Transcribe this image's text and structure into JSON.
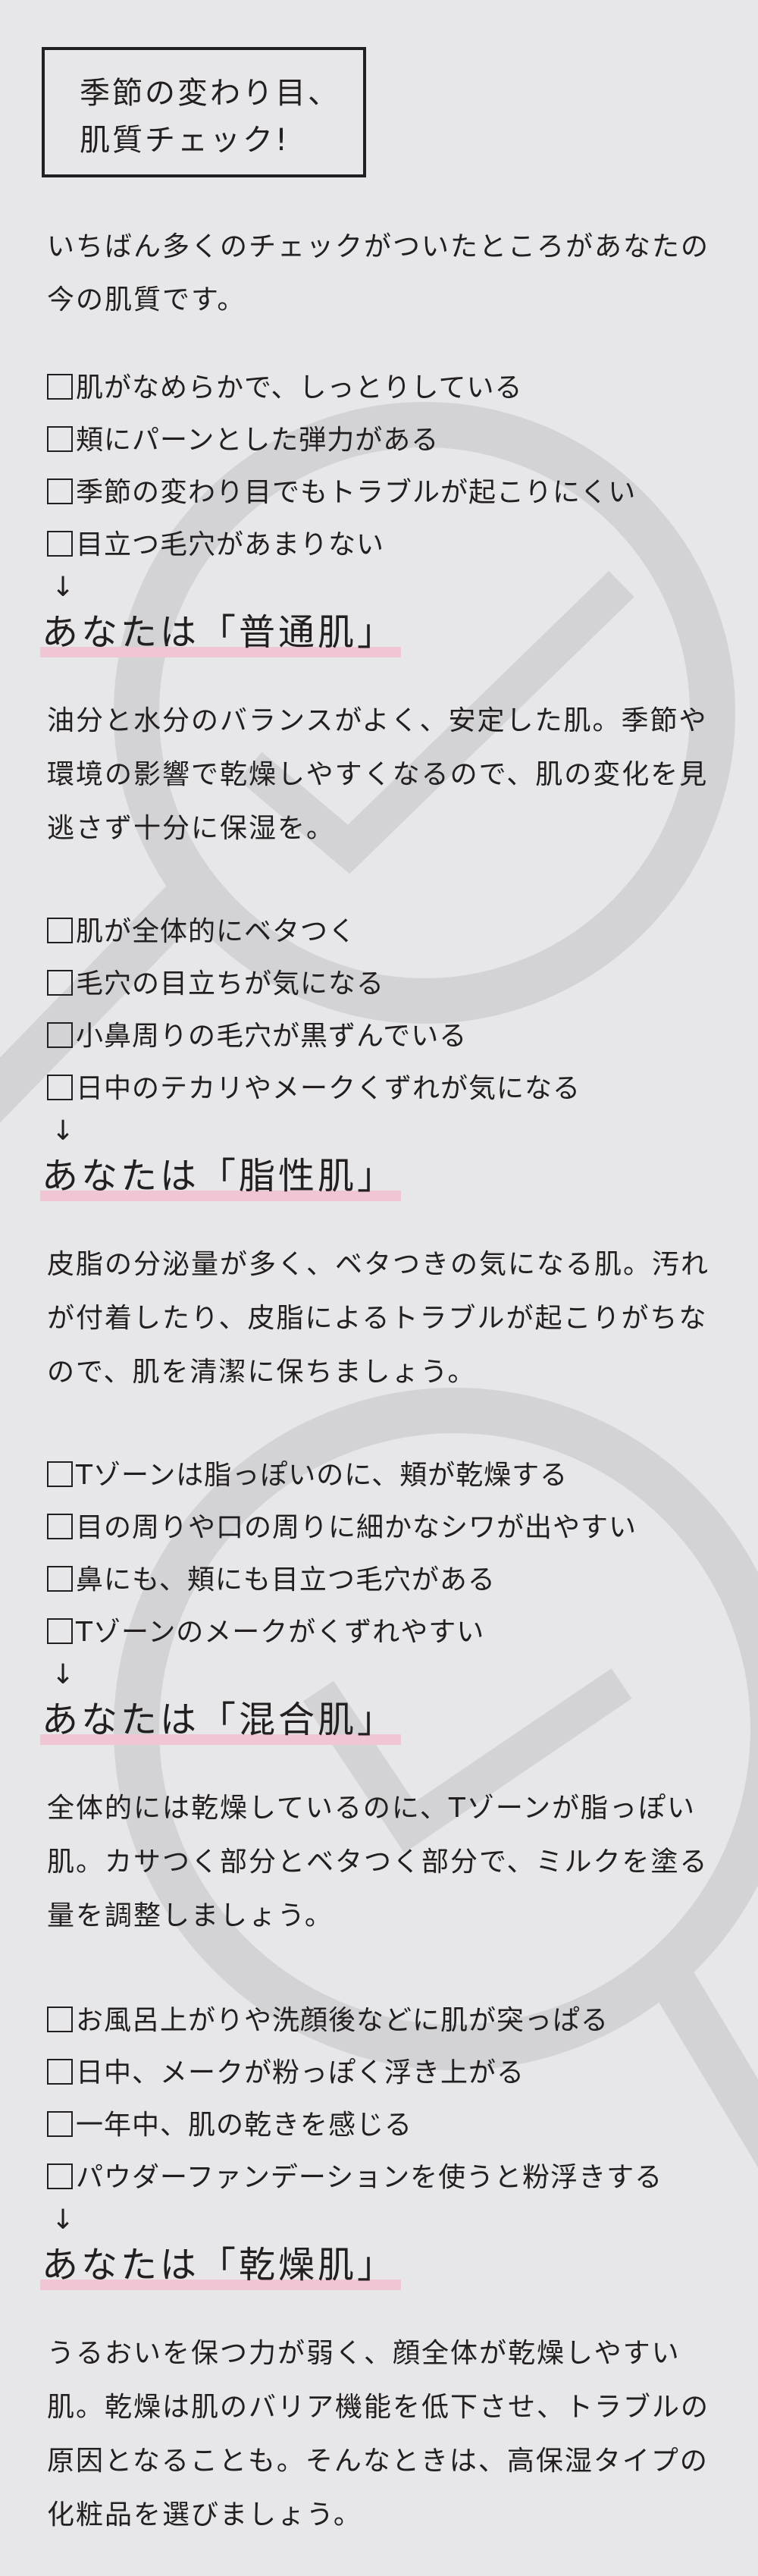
{
  "title": {
    "line1": "季節の変わり目、",
    "line2": "肌質チェック!"
  },
  "intro": "いちばん多くのチェックがついたところがあなたの今の肌質です。",
  "arrow": "↓",
  "sections": [
    {
      "items": [
        "肌がなめらかで、しっとりしている",
        "頬にパーンとした弾力がある",
        "季節の変わり目でもトラブルが起こりにくい",
        "目立つ毛穴があまりない"
      ],
      "result": "あなたは「普通肌」",
      "desc": "油分と水分のバランスがよく、安定した肌。季節や環境の影響で乾燥しやすくなるので、肌の変化を見逃さず十分に保湿を。"
    },
    {
      "items": [
        "肌が全体的にベタつく",
        "毛穴の目立ちが気になる",
        "小鼻周りの毛穴が黒ずんでいる",
        "日中のテカリやメークくずれが気になる"
      ],
      "result": "あなたは「脂性肌」",
      "desc": "皮脂の分泌量が多く、ベタつきの気になる肌。汚れが付着したり、皮脂によるトラブルが起こりがちなので、肌を清潔に保ちましょう。"
    },
    {
      "items": [
        "Tゾーンは脂っぽいのに、頬が乾燥する",
        "目の周りや口の周りに細かなシワが出やすい",
        "鼻にも、頬にも目立つ毛穴がある",
        "Tゾーンのメークがくずれやすい"
      ],
      "result": "あなたは「混合肌」",
      "desc": "全体的には乾燥しているのに、Tゾーンが脂っぽい肌。カサつく部分とベタつく部分で、ミルクを塗る量を調整しましょう。"
    },
    {
      "items": [
        "お風呂上がりや洗顔後などに肌が突っぱる",
        "日中、メークが粉っぽく浮き上がる",
        "一年中、肌の乾きを感じる",
        "パウダーファンデーションを使うと粉浮きする"
      ],
      "result": "あなたは「乾燥肌」",
      "desc": "うるおいを保つ力が弱く、顔全体が乾燥しやすい肌。乾燥は肌のバリア機能を低下させ、トラブルの原因となることも。そんなときは、高保湿タイプの化粧品を選びましょう。"
    }
  ],
  "colors": {
    "background": "#e7e7e9",
    "text": "#231f20",
    "highlight": "#f1c6d4",
    "watermark": "#d3d3d6"
  }
}
